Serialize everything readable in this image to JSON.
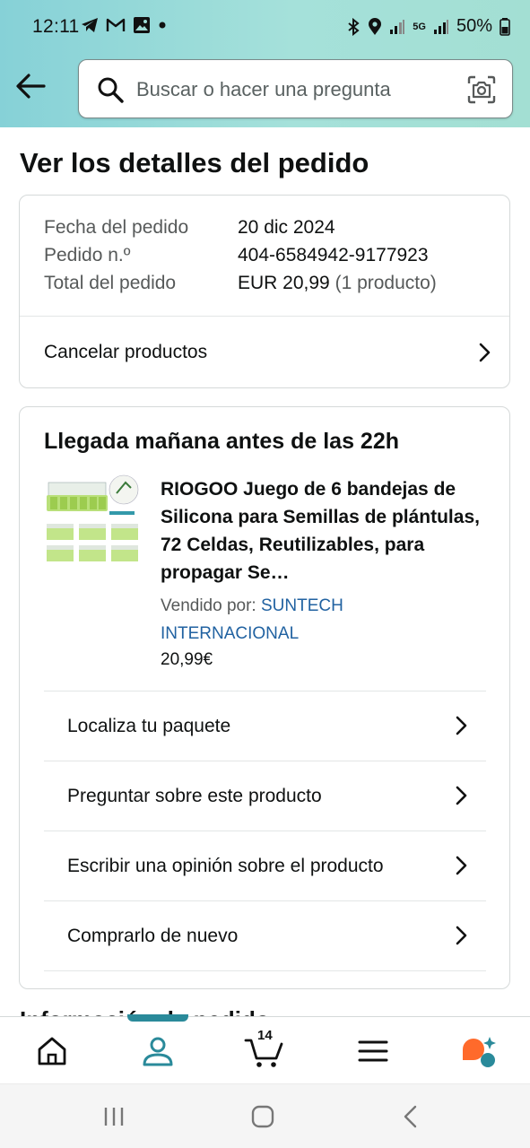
{
  "status_bar": {
    "time": "12:11",
    "battery": "50%",
    "network": "5G"
  },
  "search": {
    "placeholder": "Buscar o hacer una pregunta"
  },
  "page": {
    "title": "Ver los detalles del pedido"
  },
  "order": {
    "date_label": "Fecha del pedido",
    "date_value": "20 dic 2024",
    "number_label": "Pedido n.º",
    "number_value": "404-6584942-9177923",
    "total_label": "Total del pedido",
    "total_value": "EUR 20,99",
    "total_count": "(1 producto)",
    "cancel_label": "Cancelar productos"
  },
  "delivery": {
    "title": "Llegada mañana antes de las 22h",
    "product_title": "RIOGOO Juego de 6 bandejas de Silicona para Semillas de plántulas, 72 Celdas, Reutilizables, para propagar Se…",
    "sold_by_label": "Vendido por:",
    "seller": "SUNTECH INTERNACIONAL",
    "price": "20,99€",
    "actions": [
      {
        "label": "Localiza tu paquete"
      },
      {
        "label": "Preguntar sobre este producto"
      },
      {
        "label": "Escribir una opinión sobre el producto"
      },
      {
        "label": "Comprarlo de nuevo"
      }
    ]
  },
  "peek_heading": "Información de pedido",
  "bottom_nav": {
    "cart_count": "14",
    "items": [
      "home-icon",
      "account-icon",
      "cart-icon",
      "menu-icon",
      "rufus-icon"
    ]
  },
  "colors": {
    "accent": "#2a8a9a",
    "link": "#2162a1",
    "header_start": "#86d1d7",
    "header_end": "#a3dfd3"
  }
}
